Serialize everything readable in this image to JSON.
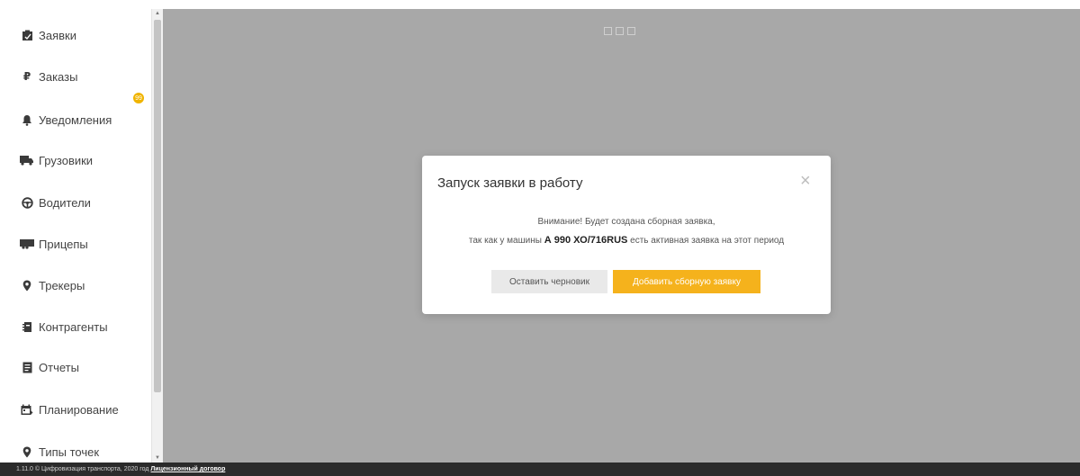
{
  "sidebar": {
    "items": [
      {
        "label": "Заявки",
        "icon": "clipboard-icon"
      },
      {
        "label": "Заказы",
        "icon": "ruble-icon"
      },
      {
        "label": "Уведомления",
        "icon": "bell-icon",
        "badge": "99"
      },
      {
        "label": "Грузовики",
        "icon": "truck-icon"
      },
      {
        "label": "Водители",
        "icon": "steering-wheel-icon"
      },
      {
        "label": "Прицепы",
        "icon": "trailer-icon"
      },
      {
        "label": "Трекеры",
        "icon": "map-pin-icon"
      },
      {
        "label": "Контрагенты",
        "icon": "contacts-icon"
      },
      {
        "label": "Отчеты",
        "icon": "report-icon"
      },
      {
        "label": "Планирование",
        "icon": "calendar-icon"
      },
      {
        "label": "Типы точек",
        "icon": "map-pin-icon"
      }
    ]
  },
  "modal": {
    "title": "Запуск заявки в работу",
    "line1": "Внимание! Будет создана сборная заявка,",
    "line2_prefix": "так как у машины ",
    "plate": "А 990 ХО/716RUS",
    "line2_suffix": " есть активная заявка на этот период",
    "draft_button": "Оставить черновик",
    "add_button": "Добавить сборную заявку"
  },
  "footer": {
    "text": "1.11.0 © Цифровизация транспорта, 2020 год ",
    "link": "Лицензионный договор"
  },
  "colors": {
    "accent": "#f5b21c",
    "overlay": "#a8a8a8",
    "footer": "#2b2b2b"
  }
}
